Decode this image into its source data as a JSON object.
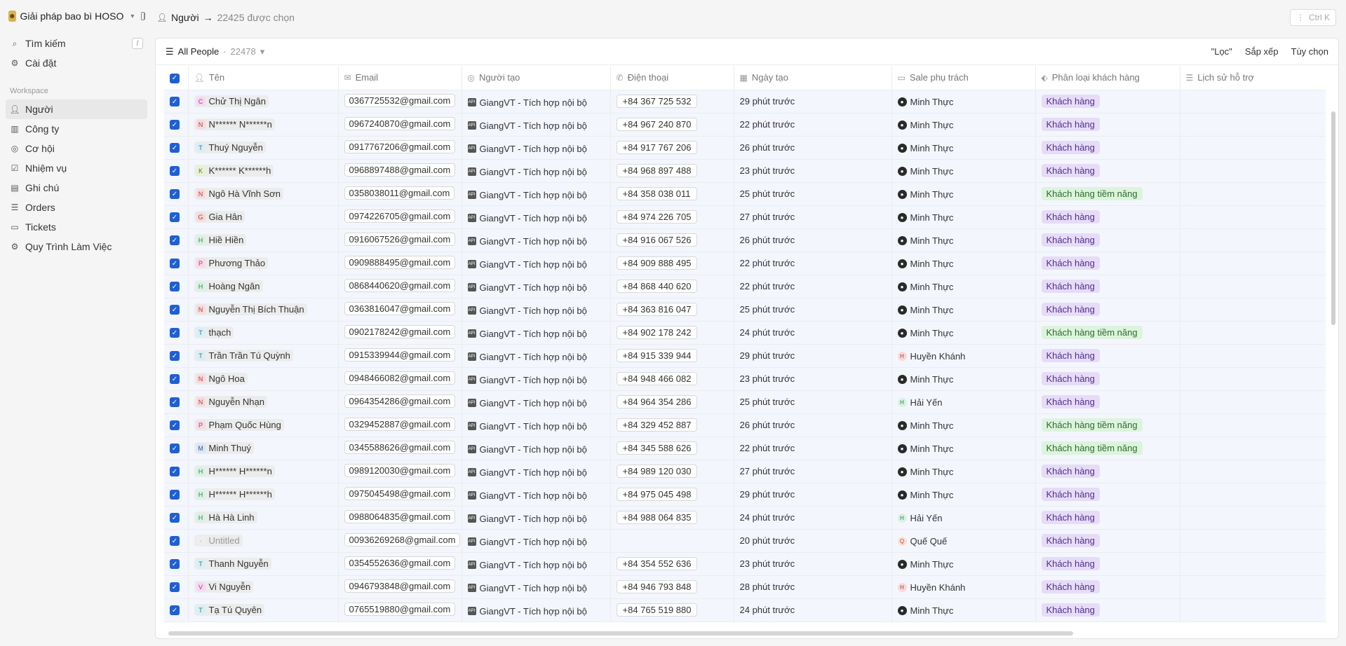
{
  "workspace": {
    "name": "Giải pháp bao bì HOSO"
  },
  "nav_top": [
    {
      "label": "Tìm kiếm",
      "icon": "search-icon",
      "shortcut": "/"
    },
    {
      "label": "Cài đặt",
      "icon": "gear-icon"
    }
  ],
  "workspace_label": "Workspace",
  "nav": [
    {
      "label": "Người",
      "icon": "person-icon",
      "active": true
    },
    {
      "label": "Công ty",
      "icon": "building-icon"
    },
    {
      "label": "Cơ hội",
      "icon": "target-icon"
    },
    {
      "label": "Nhiệm vụ",
      "icon": "checkbox-icon"
    },
    {
      "label": "Ghi chú",
      "icon": "note-icon"
    },
    {
      "label": "Orders",
      "icon": "list-icon"
    },
    {
      "label": "Tickets",
      "icon": "ticket-icon"
    },
    {
      "label": "Quy Trình Làm Việc",
      "icon": "workflow-icon"
    }
  ],
  "breadcrumb": {
    "object": "Người",
    "selection": "22425 được chọn"
  },
  "topbar": {
    "menu_label": "Ctrl K"
  },
  "view": {
    "name": "All People",
    "count": "22478"
  },
  "actions": {
    "filter": "\"Lọc\"",
    "sort": "Sắp xếp",
    "options": "Tùy chọn"
  },
  "columns": [
    "Tên",
    "Email",
    "Người tạo",
    "Điện thoại",
    "Ngày tạo",
    "Sale phụ trách",
    "Phân loại khách hàng",
    "Lịch sử hỗ trợ"
  ],
  "colors": {
    "accent": "#1e5fd6",
    "tag_customer": "#e7dcf8",
    "tag_prospect": "#dcf3dc"
  },
  "rows": [
    {
      "initial": "C",
      "name": "Chử Thị Ngân",
      "email": "0367725532@gmail.com",
      "creator": "GiangVT - Tích hợp nội bộ",
      "phone": "+84 367 725 532",
      "created": "29 phút trước",
      "sale": "Minh Thực",
      "type": "Khách hàng"
    },
    {
      "initial": "N",
      "name": "N****** N******n",
      "email": "0967240870@gmail.com",
      "creator": "GiangVT - Tích hợp nội bộ",
      "phone": "+84 967 240 870",
      "created": "22 phút trước",
      "sale": "Minh Thực",
      "type": "Khách hàng"
    },
    {
      "initial": "T",
      "name": "Thuý Nguyễn",
      "email": "0917767206@gmail.com",
      "creator": "GiangVT - Tích hợp nội bộ",
      "phone": "+84 917 767 206",
      "created": "26 phút trước",
      "sale": "Minh Thực",
      "type": "Khách hàng"
    },
    {
      "initial": "K",
      "name": "K****** K******h",
      "email": "0968897488@gmail.com",
      "creator": "GiangVT - Tích hợp nội bộ",
      "phone": "+84 968 897 488",
      "created": "23 phút trước",
      "sale": "Minh Thực",
      "type": "Khách hàng"
    },
    {
      "initial": "N",
      "name": "Ngô Hà Vĩnh Sơn",
      "email": "0358038011@gmail.com",
      "creator": "GiangVT - Tích hợp nội bộ",
      "phone": "+84 358 038 011",
      "created": "25 phút trước",
      "sale": "Minh Thực",
      "type": "Khách hàng tiềm năng"
    },
    {
      "initial": "G",
      "name": "Gia Hân",
      "email": "0974226705@gmail.com",
      "creator": "GiangVT - Tích hợp nội bộ",
      "phone": "+84 974 226 705",
      "created": "27 phút trước",
      "sale": "Minh Thực",
      "type": "Khách hàng"
    },
    {
      "initial": "H",
      "name": "Hiề Hiền",
      "email": "0916067526@gmail.com",
      "creator": "GiangVT - Tích hợp nội bộ",
      "phone": "+84 916 067 526",
      "created": "26 phút trước",
      "sale": "Minh Thực",
      "type": "Khách hàng"
    },
    {
      "initial": "P",
      "name": "Phương Thảo",
      "email": "0909888495@gmail.com",
      "creator": "GiangVT - Tích hợp nội bộ",
      "phone": "+84 909 888 495",
      "created": "22 phút trước",
      "sale": "Minh Thực",
      "type": "Khách hàng"
    },
    {
      "initial": "H",
      "name": "Hoàng Ngân",
      "email": "0868440620@gmail.com",
      "creator": "GiangVT - Tích hợp nội bộ",
      "phone": "+84 868 440 620",
      "created": "22 phút trước",
      "sale": "Minh Thực",
      "type": "Khách hàng"
    },
    {
      "initial": "N",
      "name": "Nguyễn Thị Bích Thuận",
      "email": "0363816047@gmail.com",
      "creator": "GiangVT - Tích hợp nội bộ",
      "phone": "+84 363 816 047",
      "created": "25 phút trước",
      "sale": "Minh Thực",
      "type": "Khách hàng"
    },
    {
      "initial": "T",
      "name": "thạch",
      "email": "0902178242@gmail.com",
      "creator": "GiangVT - Tích hợp nội bộ",
      "phone": "+84 902 178 242",
      "created": "24 phút trước",
      "sale": "Minh Thực",
      "type": "Khách hàng tiềm năng"
    },
    {
      "initial": "T",
      "name": "Trần Trần Tú Quỳnh",
      "email": "0915339944@gmail.com",
      "creator": "GiangVT - Tích hợp nội bộ",
      "phone": "+84 915 339 944",
      "created": "29 phút trước",
      "sale": "Huyền Khánh",
      "sale_initial": "H",
      "type": "Khách hàng"
    },
    {
      "initial": "N",
      "name": "Ngô Hoa",
      "email": "0948466082@gmail.com",
      "creator": "GiangVT - Tích hợp nội bộ",
      "phone": "+84 948 466 082",
      "created": "23 phút trước",
      "sale": "Minh Thực",
      "type": "Khách hàng"
    },
    {
      "initial": "N",
      "name": "Nguyễn Nhạn",
      "email": "0964354286@gmail.com",
      "creator": "GiangVT - Tích hợp nội bộ",
      "phone": "+84 964 354 286",
      "created": "25 phút trước",
      "sale": "Hải Yến",
      "sale_initial": "H",
      "type": "Khách hàng"
    },
    {
      "initial": "P",
      "name": "Phạm Quốc Hùng",
      "email": "0329452887@gmail.com",
      "creator": "GiangVT - Tích hợp nội bộ",
      "phone": "+84 329 452 887",
      "created": "26 phút trước",
      "sale": "Minh Thực",
      "type": "Khách hàng tiềm năng"
    },
    {
      "initial": "M",
      "name": "Minh Thuý",
      "email": "0345588626@gmail.com",
      "creator": "GiangVT - Tích hợp nội bộ",
      "phone": "+84 345 588 626",
      "created": "22 phút trước",
      "sale": "Minh Thực",
      "type": "Khách hàng tiềm năng"
    },
    {
      "initial": "H",
      "name": "H****** H******n",
      "email": "0989120030@gmail.com",
      "creator": "GiangVT - Tích hợp nội bộ",
      "phone": "+84 989 120 030",
      "created": "27 phút trước",
      "sale": "Minh Thực",
      "type": "Khách hàng"
    },
    {
      "initial": "H",
      "name": "H****** H******h",
      "email": "0975045498@gmail.com",
      "creator": "GiangVT - Tích hợp nội bộ",
      "phone": "+84 975 045 498",
      "created": "29 phút trước",
      "sale": "Minh Thực",
      "type": "Khách hàng"
    },
    {
      "initial": "H",
      "name": "Hà Hà Linh",
      "email": "0988064835@gmail.com",
      "creator": "GiangVT - Tích hợp nội bộ",
      "phone": "+84 988 064 835",
      "created": "24 phút trước",
      "sale": "Hải Yến",
      "sale_initial": "H",
      "type": "Khách hàng"
    },
    {
      "initial": "-",
      "name": "Untitled",
      "untitled": true,
      "email": "00936269268@gmail.com",
      "creator": "GiangVT - Tích hợp nội bộ",
      "phone": "",
      "created": "20 phút trước",
      "sale": "Quế Quế",
      "sale_initial": "Q",
      "type": "Khách hàng"
    },
    {
      "initial": "T",
      "name": "Thanh Nguyễn",
      "email": "0354552636@gmail.com",
      "creator": "GiangVT - Tích hợp nội bộ",
      "phone": "+84 354 552 636",
      "created": "23 phút trước",
      "sale": "Minh Thực",
      "type": "Khách hàng"
    },
    {
      "initial": "V",
      "name": "Vi Nguyễn",
      "email": "0946793848@gmail.com",
      "creator": "GiangVT - Tích hợp nội bộ",
      "phone": "+84 946 793 848",
      "created": "28 phút trước",
      "sale": "Huyền Khánh",
      "sale_initial": "H",
      "type": "Khách hàng"
    },
    {
      "initial": "T",
      "name": "Tạ Tú Quyên",
      "email": "0765519880@gmail.com",
      "creator": "GiangVT - Tích hợp nội bộ",
      "phone": "+84 765 519 880",
      "created": "24 phút trước",
      "sale": "Minh Thực",
      "type": "Khách hàng"
    }
  ]
}
